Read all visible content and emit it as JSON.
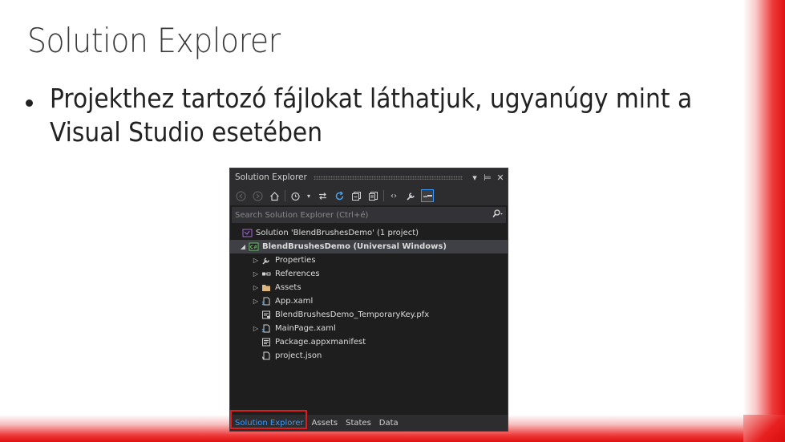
{
  "slide": {
    "title": "Solution Explorer",
    "bullet_line1": "Projekthez tartozó fájlokat láthatjuk, ugyanúgy mint a",
    "bullet_line2": "Visual Studio esetében"
  },
  "panel": {
    "title": "Solution Explorer",
    "window_buttons": [
      "▾",
      "⊨",
      "✕"
    ],
    "toolbar": [
      "back-icon",
      "forward-icon",
      "home-icon",
      "pending-changes-icon",
      "dropdown-icon",
      "sync-icon",
      "refresh-icon",
      "collapse-all-icon",
      "show-all-files-icon",
      "view-code-icon",
      "properties-icon",
      "preview-icon"
    ],
    "search": {
      "placeholder": "Search Solution Explorer (Ctrl+é)"
    },
    "tree": {
      "solution": "Solution 'BlendBrushesDemo' (1 project)",
      "project": "BlendBrushesDemo (Universal Windows)",
      "items": [
        {
          "label": "Properties",
          "icon": "wrench-icon",
          "expandable": true
        },
        {
          "label": "References",
          "icon": "references-icon",
          "expandable": true
        },
        {
          "label": "Assets",
          "icon": "folder-icon",
          "expandable": true
        },
        {
          "label": "App.xaml",
          "icon": "xaml-file-icon",
          "expandable": true
        },
        {
          "label": "BlendBrushesDemo_TemporaryKey.pfx",
          "icon": "certificate-icon",
          "expandable": false
        },
        {
          "label": "MainPage.xaml",
          "icon": "xaml-file-icon",
          "expandable": true
        },
        {
          "label": "Package.appxmanifest",
          "icon": "manifest-icon",
          "expandable": false
        },
        {
          "label": "project.json",
          "icon": "json-file-icon",
          "expandable": false
        }
      ]
    },
    "tabs": [
      "Solution Explorer",
      "Assets",
      "States",
      "Data"
    ]
  },
  "colors": {
    "accent": "#3399ff",
    "highlight": "#d81e1e",
    "panel_bg": "#1e1e1e",
    "frame_red": "#e01010"
  }
}
